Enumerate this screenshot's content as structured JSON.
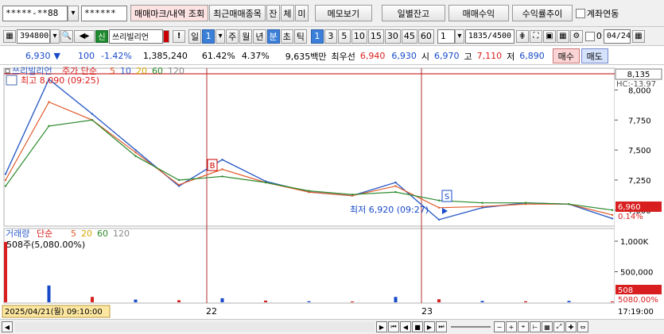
{
  "toolbar1": {
    "account": "*****-**88",
    "password": "******",
    "trade_mark_btn": "매매마크/내역 조회",
    "recent_items_btn": "최근매매종목",
    "balance_btn": "잔",
    "conclude_btn": "체",
    "unfilled_btn": "미",
    "memo_btn": "메모보기",
    "daily_balance_btn": "일별잔고",
    "trade_profit_btn": "매매수익",
    "profit_trend_btn": "수익률추이",
    "account_link_label": "계좌연동"
  },
  "toolbar2": {
    "code": "394800",
    "stock_badge": "신",
    "stock_name": "쓰리빌리언",
    "period_value": "1",
    "periods": [
      "일",
      "주",
      "월",
      "년",
      "분",
      "초",
      "틱"
    ],
    "selected_period": "분",
    "minutes": [
      "1",
      "3",
      "5",
      "10",
      "15",
      "30",
      "45",
      "60"
    ],
    "selected_minute": "1",
    "interval_select": "1",
    "count": "1835",
    "count_total": "/4500",
    "count_checkbox": "0",
    "date": "04/24"
  },
  "quote": {
    "price": "6,930",
    "change": "100",
    "change_pct": "-1.42%",
    "volume": "1,385,240",
    "vol_ratio": "61.42%",
    "turnover": "4.37%",
    "amount": "9,635백만",
    "best_label": "최우선",
    "best_ask": "6,940",
    "best_bid": "6,930",
    "open_label": "시",
    "open": "6,970",
    "high_label": "고",
    "high": "7,110",
    "low_label": "저",
    "low": "6,890",
    "buy_btn": "매수",
    "sell_btn": "매도"
  },
  "price_panel": {
    "legend_name": "쓰리빌리언",
    "legend_ma": "주가 단순",
    "ma_periods": [
      "5",
      "10",
      "20",
      "60",
      "120"
    ],
    "ma_colors": [
      "#e05a2c",
      "#2f5fc8",
      "#d8a800",
      "#2c8a2c",
      "#888888"
    ],
    "high_note": "최고 8,090 (09:25)",
    "low_note": "최저 6,920 (09:27)",
    "top_value": "8,135",
    "hc_label": "HC:-13.97",
    "current_value": "6,960",
    "current_pct": "0.14%",
    "y_ticks": [
      "8,000",
      "7,750",
      "7,500",
      "7,250",
      "7,000"
    ],
    "buy_marker": "B",
    "sell_marker": "S"
  },
  "volume_panel": {
    "legend_name": "거래량",
    "legend_ma": "단순",
    "ma_periods": [
      "5",
      "20",
      "60",
      "120"
    ],
    "ma_colors": [
      "#e05a2c",
      "#d8a800",
      "#2c8a2c",
      "#888888"
    ],
    "top_note": "508주(5,080.00%)",
    "y_ticks": [
      "1,000K",
      "500,000"
    ],
    "current_value": "508",
    "current_pct": "5080.00%"
  },
  "xaxis": {
    "cursor_date": "2025/04/21(월) 09:10:00",
    "labels": [
      "22",
      "23"
    ],
    "time_label": "17:19:00"
  },
  "chart_data": {
    "type": "line",
    "title": "쓰리빌리언",
    "xlabel": "",
    "ylabel": "",
    "ylim": [
      6880,
      8135
    ],
    "x": [
      "04/21 09:00",
      "04/21 09:25",
      "04/21 11:00",
      "04/21 13:00",
      "04/21 15:30",
      "04/22 09:05",
      "04/22 11:00",
      "04/22 13:00",
      "04/22 15:30",
      "04/23 09:05",
      "04/23 09:27",
      "04/23 11:00",
      "04/23 13:00",
      "04/23 15:30",
      "04/24 09:10"
    ],
    "series": [
      {
        "name": "주가",
        "values": [
          7300,
          8090,
          7800,
          7500,
          7200,
          7420,
          7240,
          7150,
          7120,
          7230,
          6920,
          7020,
          7060,
          7050,
          6930
        ]
      },
      {
        "name": "단순 5",
        "values": [
          7250,
          7900,
          7750,
          7480,
          7210,
          7340,
          7230,
          7150,
          7120,
          7200,
          7020,
          7030,
          7050,
          7050,
          6960
        ]
      },
      {
        "name": "단순 60",
        "values": [
          7200,
          7700,
          7750,
          7450,
          7250,
          7280,
          7230,
          7160,
          7130,
          7150,
          7080,
          7060,
          7060,
          7050,
          7000
        ]
      }
    ],
    "volume": {
      "name": "거래량",
      "values": [
        900000,
        250000,
        80000,
        40000,
        30000,
        60000,
        25000,
        15000,
        12000,
        80000,
        45000,
        20000,
        15000,
        20000,
        508
      ]
    },
    "grid": false,
    "legend": "top-left"
  }
}
